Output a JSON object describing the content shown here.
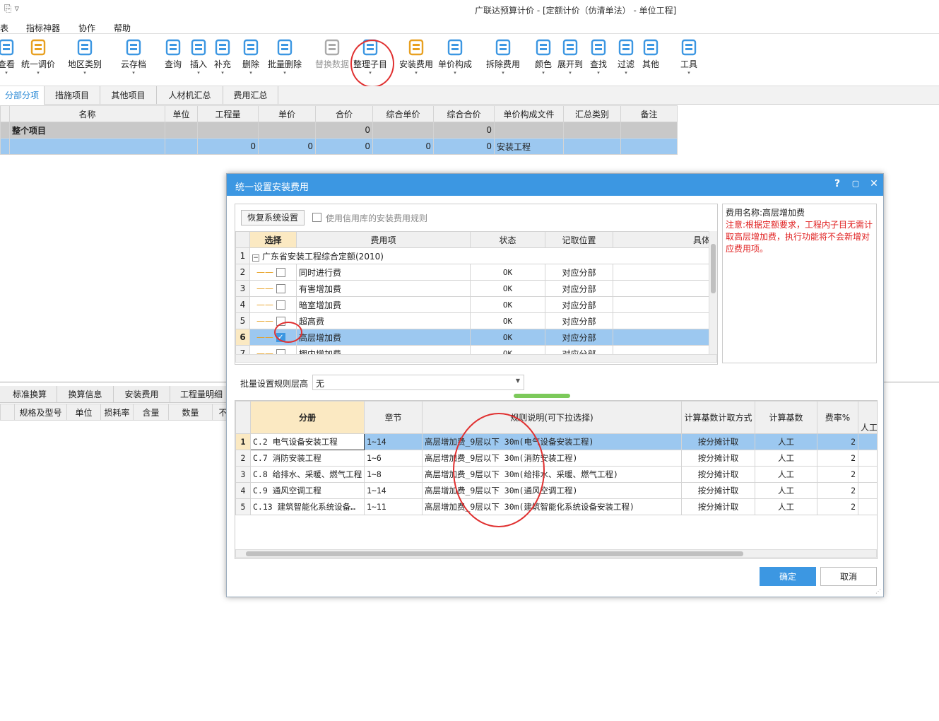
{
  "app": {
    "title": "广联达预算计价 - [定额计价（仿清单法） - 单位工程]"
  },
  "menu": [
    "表",
    "指标神器",
    "协作",
    "帮助"
  ],
  "toolbar": [
    {
      "label": "查看",
      "icon": "view-icon",
      "color": "#3c97e2"
    },
    {
      "label": "统一调价",
      "icon": "adjust-price-icon",
      "color": "#e8a020"
    },
    {
      "label": "地区类别",
      "icon": "region-icon",
      "color": "#3c97e2"
    },
    {
      "label": "云存档",
      "icon": "cloud-save-icon",
      "color": "#3c97e2"
    },
    {
      "label": "查询",
      "icon": "query-icon",
      "color": "#3c97e2"
    },
    {
      "label": "插入",
      "icon": "insert-icon",
      "color": "#3c97e2"
    },
    {
      "label": "补充",
      "icon": "supplement-icon",
      "color": "#3c97e2"
    },
    {
      "label": "删除",
      "icon": "delete-icon",
      "color": "#3c97e2"
    },
    {
      "label": "批量删除",
      "icon": "batch-delete-icon",
      "color": "#3c97e2"
    },
    {
      "label": "替换数据",
      "icon": "replace-data-icon",
      "color": "#aaaaaa"
    },
    {
      "label": "整理子目",
      "icon": "organize-items-icon",
      "color": "#3c97e2"
    },
    {
      "label": "安装费用",
      "icon": "install-fee-icon",
      "color": "#e8a020"
    },
    {
      "label": "单价构成",
      "icon": "unit-price-icon",
      "color": "#3c97e2"
    },
    {
      "label": "拆除费用",
      "icon": "demolition-fee-icon",
      "color": "#3c97e2"
    },
    {
      "label": "颜色",
      "icon": "color-icon",
      "color": "#3c97e2"
    },
    {
      "label": "展开到",
      "icon": "expand-icon",
      "color": "#3c97e2"
    },
    {
      "label": "查找",
      "icon": "find-icon",
      "color": "#3c97e2"
    },
    {
      "label": "过滤",
      "icon": "filter-icon",
      "color": "#3c97e2"
    },
    {
      "label": "其他",
      "icon": "other-icon",
      "color": "#3c97e2"
    },
    {
      "label": "工具",
      "icon": "tools-icon",
      "color": "#3c97e2"
    }
  ],
  "tabs": [
    "分部分项",
    "措施项目",
    "其他项目",
    "人材机汇总",
    "费用汇总"
  ],
  "main_grid": {
    "columns": [
      "名称",
      "单位",
      "工程量",
      "单价",
      "合价",
      "综合单价",
      "综合合价",
      "单价构成文件",
      "汇总类别",
      "备注"
    ],
    "rows": [
      {
        "name": "整个项目",
        "unit": "",
        "qty": "",
        "price": "",
        "total": "0",
        "comp_price": "",
        "comp_total": "0",
        "file": "",
        "cat": "",
        "note": ""
      },
      {
        "name": "",
        "unit": "",
        "qty": "0",
        "price": "0",
        "total": "0",
        "comp_price": "0",
        "comp_total": "0",
        "file": "安装工程",
        "cat": "",
        "note": ""
      }
    ]
  },
  "bottom_tabs": [
    "标准换算",
    "换算信息",
    "安装费用",
    "工程量明细"
  ],
  "bottom_columns": [
    "规格及型号",
    "单位",
    "损耗率",
    "含量",
    "数量",
    "不"
  ],
  "dialog": {
    "title": "统一设置安装费用",
    "help": "?",
    "restore_button": "恢复系统设置",
    "use_credit_rules": "使用信用库的安装费用规则",
    "fee_columns": [
      "选择",
      "费用项",
      "状态",
      "记取位置",
      "具体项"
    ],
    "fee_rows": [
      {
        "no": "1",
        "name": "广东省安装工程综合定额(2010)",
        "status": "",
        "pos": "",
        "checked": false,
        "group": true
      },
      {
        "no": "2",
        "name": "同时进行费",
        "status": "OK",
        "pos": "对应分部",
        "checked": false,
        "group": false
      },
      {
        "no": "3",
        "name": "有害增加费",
        "status": "OK",
        "pos": "对应分部",
        "checked": false,
        "group": false
      },
      {
        "no": "4",
        "name": "暗室增加费",
        "status": "OK",
        "pos": "对应分部",
        "checked": false,
        "group": false
      },
      {
        "no": "5",
        "name": "超高费",
        "status": "OK",
        "pos": "对应分部",
        "checked": false,
        "group": false
      },
      {
        "no": "6",
        "name": "高层增加费",
        "status": "OK",
        "pos": "对应分部",
        "checked": true,
        "group": false
      },
      {
        "no": "7",
        "name": "棚内增加费",
        "status": "OK",
        "pos": "对应分部",
        "checked": false,
        "group": false
      }
    ],
    "info_name": "费用名称:高层增加费",
    "info_note": "注意:根据定额要求，工程内子目无需计取高层增加费，执行功能将不会新增对应费用项。",
    "batch_label": "批量设置规则层高",
    "batch_value": "无",
    "rule_columns": [
      "分册",
      "章节",
      "规则说明(可下拉选择)",
      "计算基数计取方式",
      "计算基数",
      "费率%",
      "人工"
    ],
    "rule_rows": [
      {
        "no": "1",
        "vol": "C.2 电气设备安装工程",
        "chap": "1~14",
        "desc": "高层增加费_9层以下 30m(电气设备安装工程)",
        "mode": "按分摊计取",
        "base": "人工",
        "rate": "2"
      },
      {
        "no": "2",
        "vol": "C.7 消防安装工程",
        "chap": "1~6",
        "desc": "高层增加费_9层以下 30m(消防安装工程)",
        "mode": "按分摊计取",
        "base": "人工",
        "rate": "2"
      },
      {
        "no": "3",
        "vol": "C.8 给排水、采暖、燃气工程",
        "chap": "1~8",
        "desc": "高层增加费_9层以下 30m(给排水、采暖、燃气工程)",
        "mode": "按分摊计取",
        "base": "人工",
        "rate": "2"
      },
      {
        "no": "4",
        "vol": "C.9 通风空调工程",
        "chap": "1~14",
        "desc": "高层增加费_9层以下 30m(通风空调工程)",
        "mode": "按分摊计取",
        "base": "人工",
        "rate": "2"
      },
      {
        "no": "5",
        "vol": "C.13 建筑智能化系统设备…",
        "chap": "1~11",
        "desc": "高层增加费_9层以下 30m(建筑智能化系统设备安装工程)",
        "mode": "按分摊计取",
        "base": "人工",
        "rate": "2"
      }
    ],
    "ok": "确定",
    "cancel": "取消"
  }
}
